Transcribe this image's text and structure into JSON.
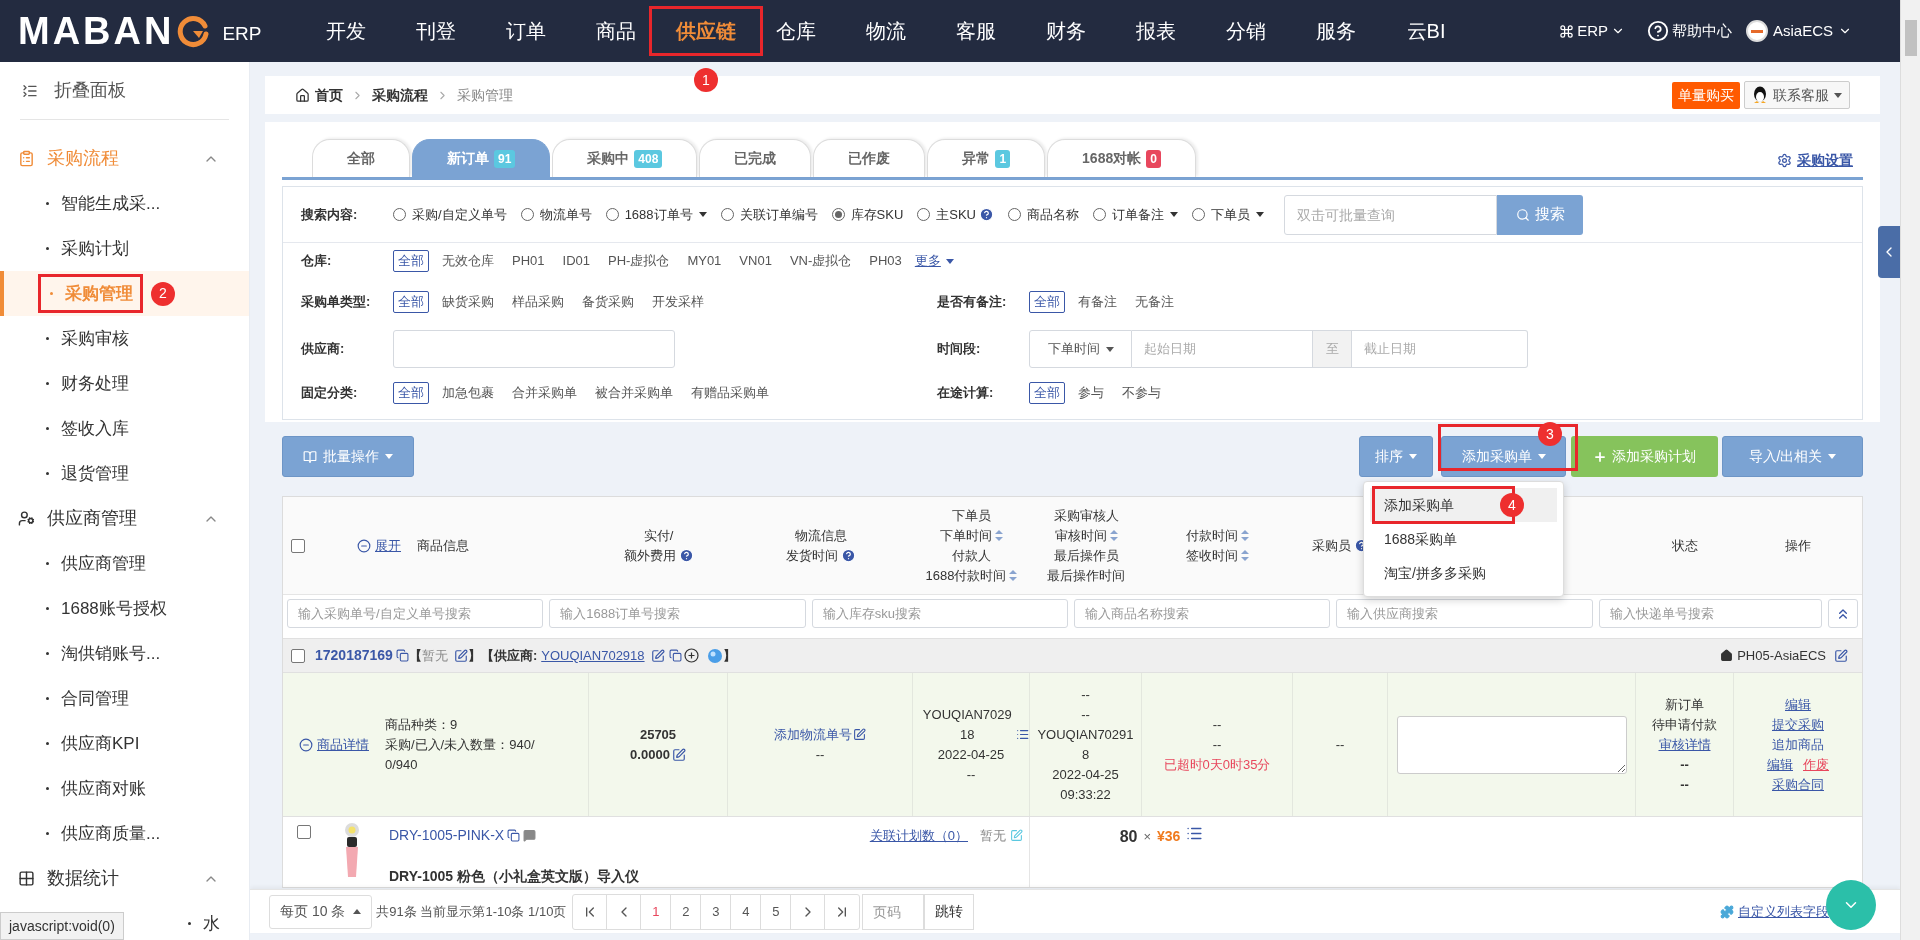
{
  "logo": {
    "text": "MABAN",
    "suffix": "ERP"
  },
  "nav": [
    {
      "label": "开发",
      "selected": false
    },
    {
      "label": "刊登",
      "selected": false
    },
    {
      "label": "订单",
      "selected": false
    },
    {
      "label": "商品",
      "selected": false
    },
    {
      "label": "供应链",
      "selected": true,
      "annotation": "1"
    },
    {
      "label": "仓库",
      "selected": false
    },
    {
      "label": "物流",
      "selected": false
    },
    {
      "label": "客服",
      "selected": false
    },
    {
      "label": "财务",
      "selected": false
    },
    {
      "label": "报表",
      "selected": false
    },
    {
      "label": "分销",
      "selected": false
    },
    {
      "label": "服务",
      "selected": false
    },
    {
      "label": "云BI",
      "selected": false
    }
  ],
  "top_right": {
    "erp": "ERP",
    "help": "帮助中心",
    "account": "AsiaECS"
  },
  "sidebar": {
    "collapse": "折叠面板",
    "groups": [
      {
        "label": "采购流程",
        "selected": true,
        "expanded": true,
        "children": [
          {
            "label": "智能生成采...",
            "selected": false
          },
          {
            "label": "采购计划",
            "selected": false
          },
          {
            "label": "采购管理",
            "selected": true,
            "annotation": "2"
          },
          {
            "label": "采购审核",
            "selected": false
          },
          {
            "label": "财务处理",
            "selected": false
          },
          {
            "label": "签收入库",
            "selected": false
          },
          {
            "label": "退货管理",
            "selected": false
          }
        ]
      },
      {
        "label": "供应商管理",
        "selected": false,
        "expanded": true,
        "children": [
          {
            "label": "供应商管理",
            "selected": false
          },
          {
            "label": "1688账号授权",
            "selected": false
          },
          {
            "label": "淘供销账号...",
            "selected": false
          },
          {
            "label": "合同管理",
            "selected": false
          },
          {
            "label": "供应商KPI",
            "selected": false
          },
          {
            "label": "供应商对账",
            "selected": false
          },
          {
            "label": "供应商质量...",
            "selected": false
          }
        ]
      },
      {
        "label": "数据统计",
        "selected": false,
        "expanded": true,
        "children": [
          {
            "label": "水",
            "selected": false,
            "kind": "partial"
          }
        ]
      }
    ]
  },
  "breadcrumb": [
    "首页",
    "采购流程",
    "采购管理"
  ],
  "buy_button": "单量购买",
  "support": "联系客服",
  "tabs": [
    {
      "label": "全部",
      "selected": false
    },
    {
      "label": "新订单",
      "count": "91",
      "color": "#5bc8e0",
      "selected": true
    },
    {
      "label": "采购中",
      "count": "408",
      "color": "#5bc8e0",
      "selected": false
    },
    {
      "label": "已完成",
      "selected": false
    },
    {
      "label": "已作废",
      "selected": false
    },
    {
      "label": "异常",
      "count": "1",
      "color": "#5bc8e0",
      "selected": false
    },
    {
      "label": "1688对帐",
      "count": "0",
      "color": "#e8475d",
      "selected": false
    }
  ],
  "settings_link": "采购设置",
  "search": {
    "label": "搜索内容:",
    "options": [
      {
        "label": "采购/自定义单号",
        "selected": false,
        "dropdown": false,
        "help": false
      },
      {
        "label": "物流单号",
        "selected": false,
        "dropdown": false,
        "help": false
      },
      {
        "label": "1688订单号",
        "selected": false,
        "dropdown": true,
        "help": false
      },
      {
        "label": "关联订单编号",
        "selected": false,
        "dropdown": false,
        "help": false
      },
      {
        "label": "库存SKU",
        "selected": true,
        "dropdown": false,
        "help": false
      },
      {
        "label": "主SKU",
        "selected": false,
        "dropdown": false,
        "help": true
      },
      {
        "label": "商品名称",
        "selected": false,
        "dropdown": false,
        "help": false
      },
      {
        "label": "订单备注",
        "selected": false,
        "dropdown": true,
        "help": false
      },
      {
        "label": "下单员",
        "selected": false,
        "dropdown": true,
        "help": false
      }
    ],
    "placeholder": "双击可批量查询",
    "button": "搜索"
  },
  "filters": {
    "warehouse": {
      "label": "仓库:",
      "options": [
        {
          "label": "全部",
          "selected": true
        },
        {
          "label": "无效仓库",
          "selected": false
        },
        {
          "label": "PH01",
          "selected": false
        },
        {
          "label": "ID01",
          "selected": false
        },
        {
          "label": "PH-虚拟仓",
          "selected": false
        },
        {
          "label": "MY01",
          "selected": false
        },
        {
          "label": "VN01",
          "selected": false
        },
        {
          "label": "VN-虚拟仓",
          "selected": false
        },
        {
          "label": "PH03",
          "selected": false
        }
      ],
      "more": "更多"
    },
    "order_type": {
      "label": "采购单类型:",
      "options": [
        {
          "label": "全部",
          "selected": true
        },
        {
          "label": "缺货采购",
          "selected": false
        },
        {
          "label": "样品采购",
          "selected": false
        },
        {
          "label": "备货采购",
          "selected": false
        },
        {
          "label": "开发采样",
          "selected": false
        }
      ]
    },
    "has_remark": {
      "label": "是否有备注:",
      "options": [
        {
          "label": "全部",
          "selected": true
        },
        {
          "label": "有备注",
          "selected": false
        },
        {
          "label": "无备注",
          "selected": false
        }
      ]
    },
    "supplier": {
      "label": "供应商:"
    },
    "period": {
      "label": "时间段:",
      "select": "下单时间",
      "start_placeholder": "起始日期",
      "separator": "至",
      "end_placeholder": "截止日期"
    },
    "category": {
      "label": "固定分类:",
      "options": [
        {
          "label": "全部",
          "selected": true
        },
        {
          "label": "加急包裹",
          "selected": false
        },
        {
          "label": "合并采购单",
          "selected": false
        },
        {
          "label": "被合并采购单",
          "selected": false
        },
        {
          "label": "有赠品采购单",
          "selected": false
        }
      ]
    },
    "in_transit": {
      "label": "在途计算:",
      "options": [
        {
          "label": "全部",
          "selected": true
        },
        {
          "label": "参与",
          "selected": false
        },
        {
          "label": "不参与",
          "selected": false
        }
      ]
    }
  },
  "toolbar": {
    "batch": "批量操作",
    "sort": "排序",
    "add_order": "添加采购单",
    "add_order_annotation": "3",
    "add_plan": "添加采购计划",
    "import_export": "导入/出相关"
  },
  "add_menu": [
    {
      "label": "添加采购单",
      "selected": true,
      "annotation": "4"
    },
    {
      "label": "1688采购单",
      "selected": false
    },
    {
      "label": "淘宝/拼多多采购",
      "selected": false
    }
  ],
  "table": {
    "select_all_checked": false,
    "expand": "展开",
    "product_header": "商品信息",
    "columns": [
      {
        "lines": [
          {
            "text": "实付/",
            "kind": "plain"
          },
          {
            "text": "额外费用",
            "kind": "help"
          }
        ]
      },
      {
        "lines": [
          {
            "text": "物流信息",
            "kind": "plain"
          },
          {
            "text": "发货时间",
            "kind": "help"
          }
        ]
      },
      {
        "lines": [
          {
            "text": "下单员",
            "kind": "plain"
          },
          {
            "text": "下单时间",
            "kind": "sort"
          },
          {
            "text": "付款人",
            "kind": "plain"
          },
          {
            "text": "1688付款时间",
            "kind": "sort"
          }
        ]
      },
      {
        "lines": [
          {
            "text": "采购审核人",
            "kind": "plain"
          },
          {
            "text": "审核时间",
            "kind": "sort"
          },
          {
            "text": "最后操作员",
            "kind": "plain"
          },
          {
            "text": "最后操作时间",
            "kind": "plain"
          }
        ]
      },
      {
        "lines": [
          {
            "text": "付款时间",
            "kind": "sort"
          },
          {
            "text": "签收时间",
            "kind": "sort"
          }
        ]
      },
      {
        "lines": [
          {
            "text": "采购员",
            "kind": "help"
          }
        ]
      },
      {
        "lines": [
          {
            "text": "状态",
            "kind": "plain"
          }
        ]
      },
      {
        "lines": [
          {
            "text": "操作",
            "kind": "plain"
          }
        ]
      }
    ],
    "search_placeholders": [
      "输入采购单号/自定义单号搜索",
      "输入1688订单号搜索",
      "输入库存sku搜索",
      "输入商品名称搜索",
      "输入供应商搜索",
      "输入快递单号搜索"
    ]
  },
  "order": {
    "checked": false,
    "id": "1720187169",
    "remark_prefix": "【",
    "remark": "暂无",
    "remark_suffix": "】",
    "supplier_label": "【供应商:",
    "supplier": "YOUQIAN702918",
    "supplier_suffix": "】",
    "warehouse": "PH05-AsiaECS",
    "details_link": "商品详情",
    "kinds": "商品种类：9",
    "quantities": "采购/已入/未入数量：940/0/940",
    "paid": "25705",
    "extra_fee": "0.0000",
    "add_tracking": "添加物流单号",
    "tracking": "--",
    "orderer": "YOUQIAN702918",
    "order_date": "2022-04-25",
    "payer": "--",
    "reviewer": "--",
    "review_time": "--",
    "last_operator": "YOUQIAN702918",
    "last_operation_time": "2022-04-25 09:33:22",
    "payment_time": "--",
    "receipt_time": "--",
    "overdue": "已超时0天0时35分",
    "buyer": "--",
    "status": [
      "新订单",
      "待申请付款"
    ],
    "review_link": "审核详情",
    "status_extra": [
      "--",
      "--"
    ],
    "action_rows": [
      [
        {
          "label": "编辑",
          "kind": "link"
        }
      ],
      [
        {
          "label": "提交采购",
          "kind": "link"
        }
      ],
      [
        {
          "label": "追加商品",
          "kind": "plain"
        }
      ],
      [
        {
          "label": "编辑",
          "kind": "link"
        },
        {
          "label": "作废",
          "kind": "danger"
        }
      ],
      [
        {
          "label": "采购合同",
          "kind": "link"
        }
      ]
    ]
  },
  "item": {
    "checked": false,
    "sku": "DRY-1005-PINK-X",
    "plan_link": "关联计划数（0）",
    "remark": "暂无",
    "quantity": "80",
    "times": "×",
    "price": "¥36",
    "title": "DRY-1005 粉色（小礼盒英文版）导入仪"
  },
  "pagination": {
    "page_size": "每页 10 条",
    "summary": "共91条 当前显示第1-10条 1/10页",
    "pages": [
      {
        "label": "1",
        "selected": true
      },
      {
        "label": "2",
        "selected": false
      },
      {
        "label": "3",
        "selected": false
      },
      {
        "label": "4",
        "selected": false
      },
      {
        "label": "5",
        "selected": false
      }
    ],
    "page_placeholder": "页码",
    "jump": "跳转",
    "custom_fields": "自定义列表字段"
  },
  "status_bar": "javascript:void(0)"
}
